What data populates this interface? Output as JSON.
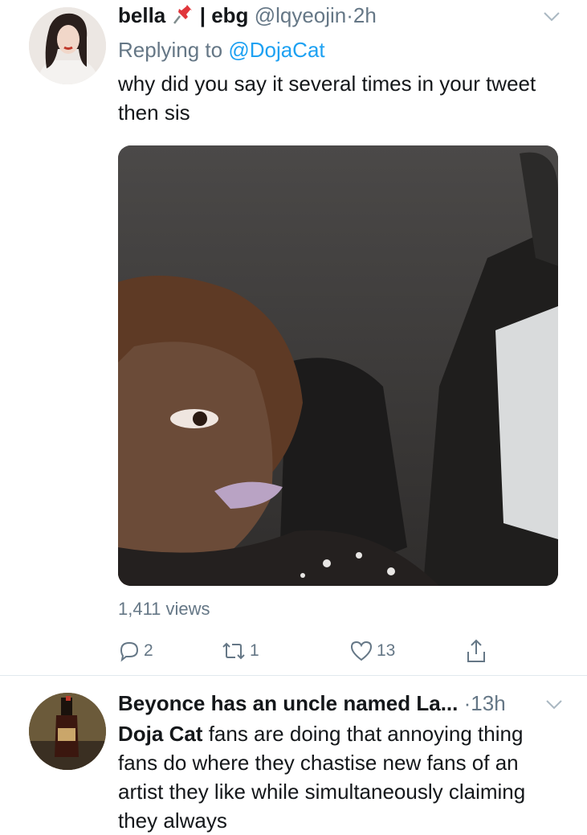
{
  "tweets": [
    {
      "name": "bella",
      "name_suffix": "| ebg",
      "handle": "@lqyeojin",
      "time": "2h",
      "reply_prefix": "Replying to",
      "reply_to": "@DojaCat",
      "text": "why did you say it several times in your tweet then sis",
      "views": "1,411 views",
      "replies": "2",
      "retweets": "1",
      "likes": "13"
    },
    {
      "name": "Beyonce has an uncle named La...",
      "time": "13h",
      "text_strong": "Doja Cat",
      "text": " fans are doing that annoying thing fans do where they chastise new fans of an artist they like while simultaneously claiming they always"
    }
  ],
  "dot": "·",
  "icons": {
    "pin": "pushpin-emoji",
    "caret": "chevron-down-icon",
    "reply": "reply-icon",
    "retweet": "retweet-icon",
    "like": "heart-icon",
    "share": "share-icon"
  },
  "colors": {
    "link": "#1da1f2",
    "secondary": "#657786",
    "text": "#14171a"
  }
}
